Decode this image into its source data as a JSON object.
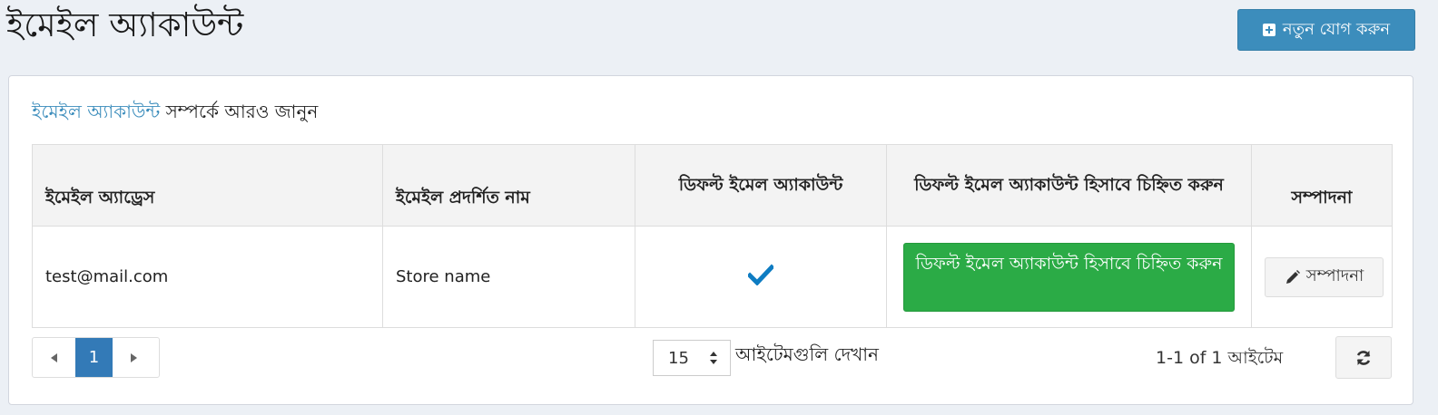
{
  "header": {
    "title": "ইমেইল অ্যাকাউন্ট",
    "add_button_label": "নতুন যোগ করুন"
  },
  "intro": {
    "link_text": "ইমেইল অ্যাকাউন্ট",
    "rest_text": " সম্পর্কে আরও জানুন"
  },
  "table": {
    "columns": [
      "ইমেইল অ্যাড্রেস",
      "ইমেইল প্রদর্শিত নাম",
      "ডিফল্ট ইমেল অ্যাকাউন্ট",
      "ডিফল্ট ইমেল অ্যাকাউন্ট হিসাবে চিহ্নিত করুন",
      "সম্পাদনা"
    ],
    "rows": [
      {
        "email": "test@mail.com",
        "display_name": "Store name",
        "is_default": true,
        "mark_default_label": "ডিফল্ট ইমেল অ্যাকাউন্ট হিসাবে চিহ্নিত করুন",
        "edit_label": "সম্পাদনা"
      }
    ]
  },
  "pager": {
    "current_page": "1",
    "page_size": "15",
    "page_size_label": "আইটেমগুলি দেখান",
    "items_info": "1-1 of 1 আইটেম"
  },
  "colors": {
    "primary": "#3c8dbc",
    "success": "#2bab46",
    "page_active": "#337ab7",
    "check": "#0e7cc2"
  },
  "icons": {
    "add": "plus-square-icon",
    "check": "check-icon",
    "edit": "pencil-icon",
    "prev": "triangle-left-icon",
    "next": "triangle-right-icon",
    "refresh": "refresh-icon"
  }
}
